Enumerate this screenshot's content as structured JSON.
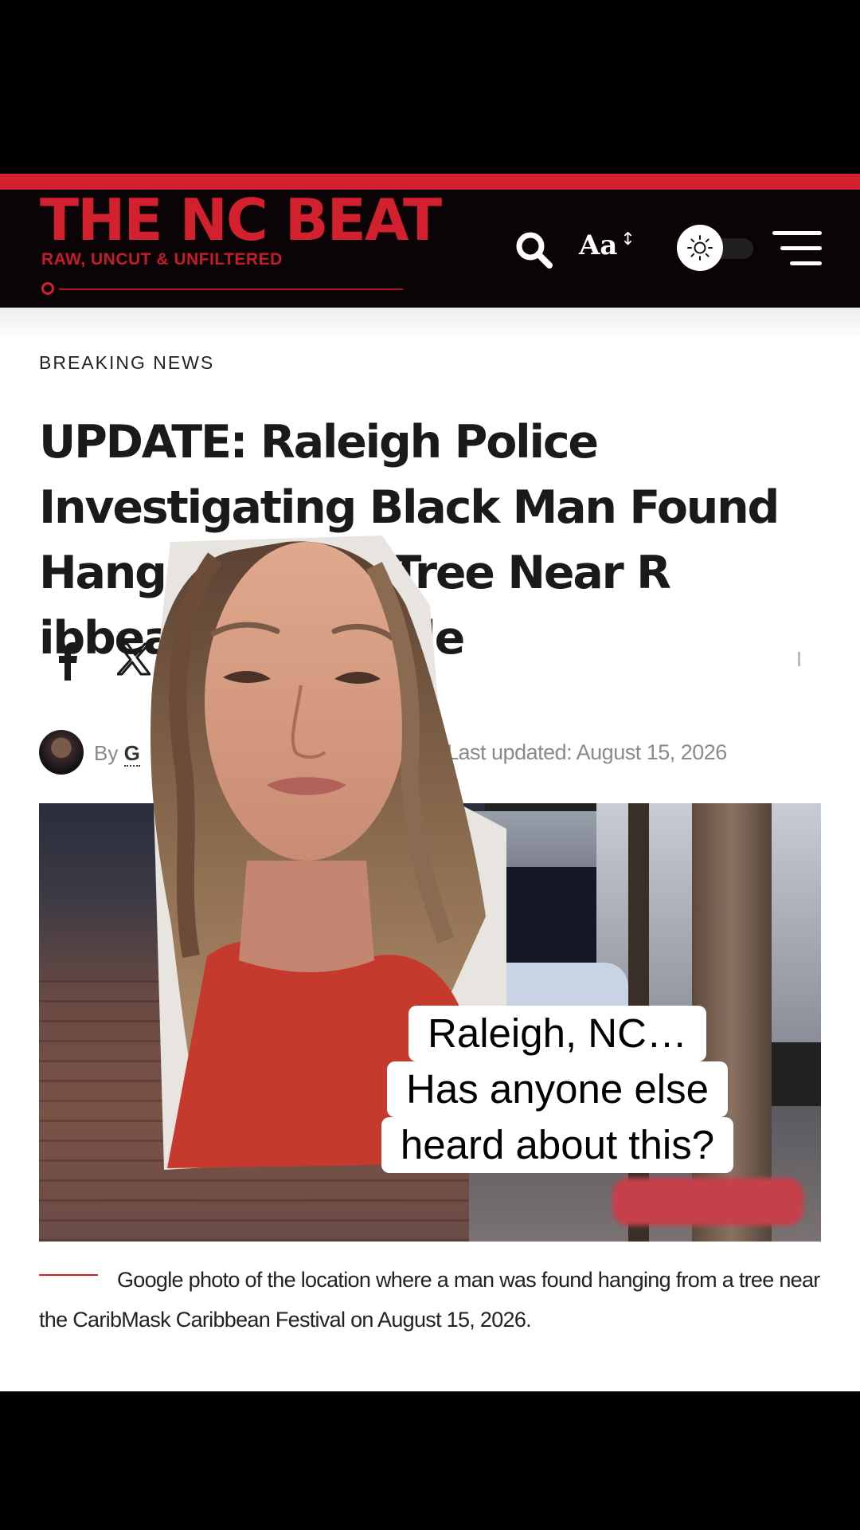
{
  "site": {
    "title": "THE NC BEAT",
    "tagline": "RAW, UNCUT & UNFILTERED",
    "font_size_label": "Aa",
    "font_size_arrows": "↕",
    "theme_mode": "light",
    "colors": {
      "brand_red": "#d3202e",
      "header_bg": "#0b0406"
    }
  },
  "article": {
    "category": "BREAKING NEWS",
    "headline": "UPDATE: Raleigh Police Investigating Black Man Found Hanging From Tree Near R          ibbean As Suicide",
    "share": [
      "facebook-icon",
      "x-icon"
    ],
    "byline_prefix": "By",
    "author_visible": "G",
    "separator": "/",
    "last_updated": "Last updated: August 15, 2026",
    "caption": "Google photo of the location where a man was found hanging from a tree near the CaribMask Caribbean Festival on August 15, 2026."
  },
  "overlay": {
    "subtitle_lines": [
      "Raleigh, NC…",
      "Has anyone else",
      "heard about this?"
    ]
  }
}
